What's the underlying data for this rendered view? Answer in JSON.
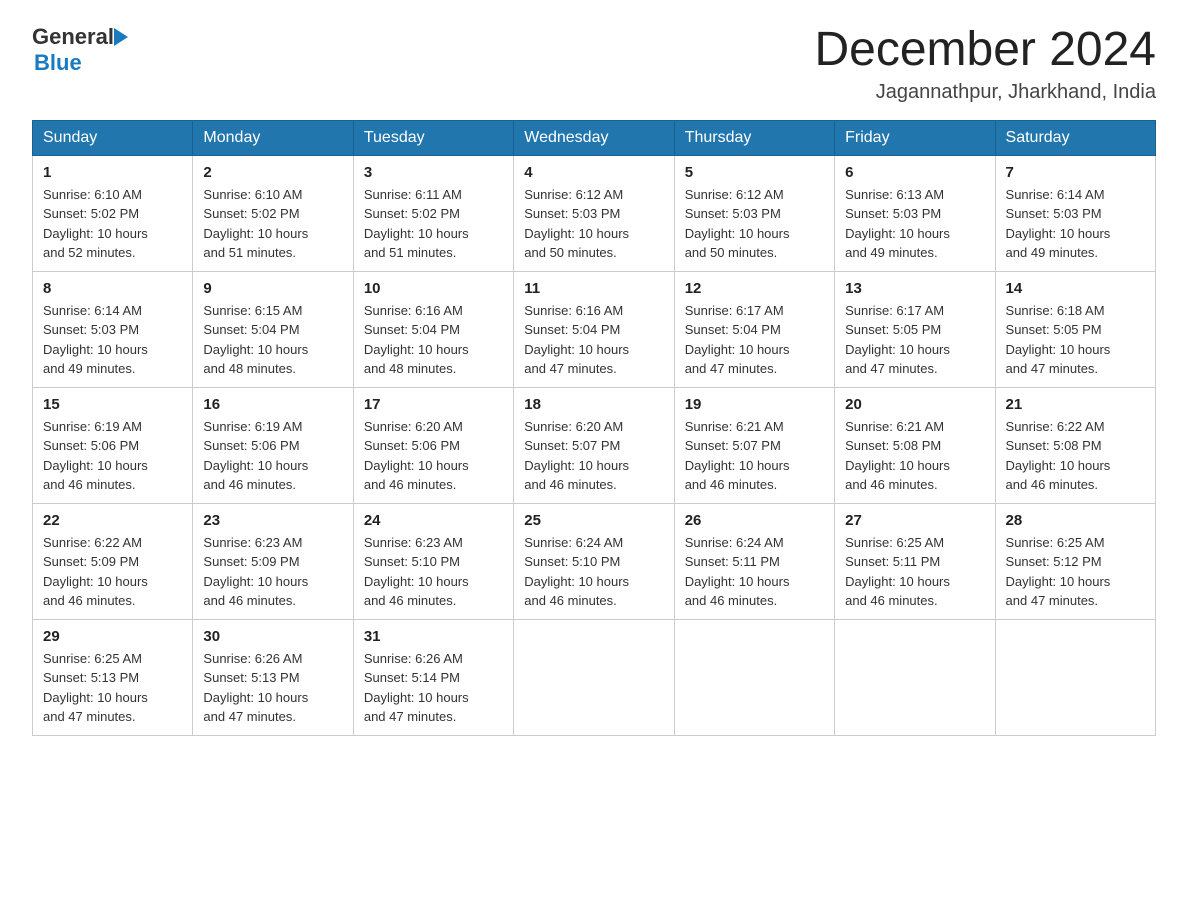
{
  "logo": {
    "general_text": "General",
    "blue_text": "Blue"
  },
  "title": "December 2024",
  "subtitle": "Jagannathpur, Jharkhand, India",
  "weekdays": [
    "Sunday",
    "Monday",
    "Tuesday",
    "Wednesday",
    "Thursday",
    "Friday",
    "Saturday"
  ],
  "weeks": [
    [
      {
        "day": "1",
        "sunrise": "6:10 AM",
        "sunset": "5:02 PM",
        "daylight": "10 hours and 52 minutes."
      },
      {
        "day": "2",
        "sunrise": "6:10 AM",
        "sunset": "5:02 PM",
        "daylight": "10 hours and 51 minutes."
      },
      {
        "day": "3",
        "sunrise": "6:11 AM",
        "sunset": "5:02 PM",
        "daylight": "10 hours and 51 minutes."
      },
      {
        "day": "4",
        "sunrise": "6:12 AM",
        "sunset": "5:03 PM",
        "daylight": "10 hours and 50 minutes."
      },
      {
        "day": "5",
        "sunrise": "6:12 AM",
        "sunset": "5:03 PM",
        "daylight": "10 hours and 50 minutes."
      },
      {
        "day": "6",
        "sunrise": "6:13 AM",
        "sunset": "5:03 PM",
        "daylight": "10 hours and 49 minutes."
      },
      {
        "day": "7",
        "sunrise": "6:14 AM",
        "sunset": "5:03 PM",
        "daylight": "10 hours and 49 minutes."
      }
    ],
    [
      {
        "day": "8",
        "sunrise": "6:14 AM",
        "sunset": "5:03 PM",
        "daylight": "10 hours and 49 minutes."
      },
      {
        "day": "9",
        "sunrise": "6:15 AM",
        "sunset": "5:04 PM",
        "daylight": "10 hours and 48 minutes."
      },
      {
        "day": "10",
        "sunrise": "6:16 AM",
        "sunset": "5:04 PM",
        "daylight": "10 hours and 48 minutes."
      },
      {
        "day": "11",
        "sunrise": "6:16 AM",
        "sunset": "5:04 PM",
        "daylight": "10 hours and 47 minutes."
      },
      {
        "day": "12",
        "sunrise": "6:17 AM",
        "sunset": "5:04 PM",
        "daylight": "10 hours and 47 minutes."
      },
      {
        "day": "13",
        "sunrise": "6:17 AM",
        "sunset": "5:05 PM",
        "daylight": "10 hours and 47 minutes."
      },
      {
        "day": "14",
        "sunrise": "6:18 AM",
        "sunset": "5:05 PM",
        "daylight": "10 hours and 47 minutes."
      }
    ],
    [
      {
        "day": "15",
        "sunrise": "6:19 AM",
        "sunset": "5:06 PM",
        "daylight": "10 hours and 46 minutes."
      },
      {
        "day": "16",
        "sunrise": "6:19 AM",
        "sunset": "5:06 PM",
        "daylight": "10 hours and 46 minutes."
      },
      {
        "day": "17",
        "sunrise": "6:20 AM",
        "sunset": "5:06 PM",
        "daylight": "10 hours and 46 minutes."
      },
      {
        "day": "18",
        "sunrise": "6:20 AM",
        "sunset": "5:07 PM",
        "daylight": "10 hours and 46 minutes."
      },
      {
        "day": "19",
        "sunrise": "6:21 AM",
        "sunset": "5:07 PM",
        "daylight": "10 hours and 46 minutes."
      },
      {
        "day": "20",
        "sunrise": "6:21 AM",
        "sunset": "5:08 PM",
        "daylight": "10 hours and 46 minutes."
      },
      {
        "day": "21",
        "sunrise": "6:22 AM",
        "sunset": "5:08 PM",
        "daylight": "10 hours and 46 minutes."
      }
    ],
    [
      {
        "day": "22",
        "sunrise": "6:22 AM",
        "sunset": "5:09 PM",
        "daylight": "10 hours and 46 minutes."
      },
      {
        "day": "23",
        "sunrise": "6:23 AM",
        "sunset": "5:09 PM",
        "daylight": "10 hours and 46 minutes."
      },
      {
        "day": "24",
        "sunrise": "6:23 AM",
        "sunset": "5:10 PM",
        "daylight": "10 hours and 46 minutes."
      },
      {
        "day": "25",
        "sunrise": "6:24 AM",
        "sunset": "5:10 PM",
        "daylight": "10 hours and 46 minutes."
      },
      {
        "day": "26",
        "sunrise": "6:24 AM",
        "sunset": "5:11 PM",
        "daylight": "10 hours and 46 minutes."
      },
      {
        "day": "27",
        "sunrise": "6:25 AM",
        "sunset": "5:11 PM",
        "daylight": "10 hours and 46 minutes."
      },
      {
        "day": "28",
        "sunrise": "6:25 AM",
        "sunset": "5:12 PM",
        "daylight": "10 hours and 47 minutes."
      }
    ],
    [
      {
        "day": "29",
        "sunrise": "6:25 AM",
        "sunset": "5:13 PM",
        "daylight": "10 hours and 47 minutes."
      },
      {
        "day": "30",
        "sunrise": "6:26 AM",
        "sunset": "5:13 PM",
        "daylight": "10 hours and 47 minutes."
      },
      {
        "day": "31",
        "sunrise": "6:26 AM",
        "sunset": "5:14 PM",
        "daylight": "10 hours and 47 minutes."
      },
      null,
      null,
      null,
      null
    ]
  ],
  "labels": {
    "sunrise": "Sunrise:",
    "sunset": "Sunset:",
    "daylight": "Daylight:"
  }
}
